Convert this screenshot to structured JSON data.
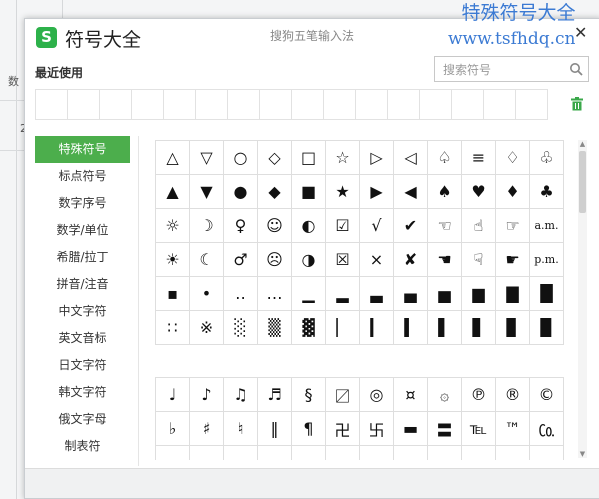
{
  "background": {
    "side_text": "数",
    "row_number": "2"
  },
  "dialog": {
    "logo_letter": "S",
    "title": "符号大全",
    "subtitle": "搜狗五笔输入法",
    "close": "✕",
    "recent_label": "最近使用",
    "search_placeholder": "搜索符号"
  },
  "sidebar": [
    {
      "label": "特殊符号",
      "active": true
    },
    {
      "label": "标点符号"
    },
    {
      "label": "数字序号"
    },
    {
      "label": "数学/单位"
    },
    {
      "label": "希腊/拉丁"
    },
    {
      "label": "拼音/注音"
    },
    {
      "label": "中文字符"
    },
    {
      "label": "英文音标"
    },
    {
      "label": "日文字符"
    },
    {
      "label": "韩文字符"
    },
    {
      "label": "俄文字母"
    },
    {
      "label": "制表符"
    }
  ],
  "symbols_section1": [
    [
      "△",
      "▽",
      "○",
      "◇",
      "□",
      "☆",
      "▷",
      "◁",
      "♤",
      "≡",
      "♢",
      "♧"
    ],
    [
      "▲",
      "▼",
      "●",
      "◆",
      "■",
      "★",
      "▶",
      "◀",
      "♠",
      "♥",
      "♦",
      "♣"
    ],
    [
      "☼",
      "☽",
      "♀",
      "☺",
      "◐",
      "☑",
      "√",
      "✔",
      "☜",
      "☝",
      "☞",
      "a.m."
    ],
    [
      "☀",
      "☾",
      "♂",
      "☹",
      "◑",
      "☒",
      "×",
      "✘",
      "☚",
      "☟",
      "☛",
      "p.m."
    ],
    [
      "▪",
      "•",
      "‥",
      "…",
      "▁",
      "▂",
      "▃",
      "▄",
      "▅",
      "▆",
      "▇",
      "█"
    ],
    [
      "∷",
      "※",
      "░",
      "▒",
      "▓",
      "▏",
      "▎",
      "▍",
      "▌",
      "▋",
      "▊",
      "▉"
    ]
  ],
  "symbols_section2": [
    [
      "♩",
      "♪",
      "♫",
      "♬",
      "§",
      "〼",
      "◎",
      "¤",
      "۞",
      "℗",
      "®",
      "©"
    ],
    [
      "♭",
      "♯",
      "♮",
      "‖",
      "¶",
      "卍",
      "卐",
      "▬",
      "〓",
      "℡",
      "™",
      "㏇"
    ],
    [
      "",
      "",
      "",
      "",
      "",
      "",
      "",
      "",
      "",
      "",
      "",
      ""
    ]
  ],
  "watermark": {
    "line1": "特殊符号大全",
    "line2": "www.tsfhdq.cn"
  },
  "colors": {
    "accent": "#4cae4c",
    "watermark": "#3b7ad3"
  }
}
